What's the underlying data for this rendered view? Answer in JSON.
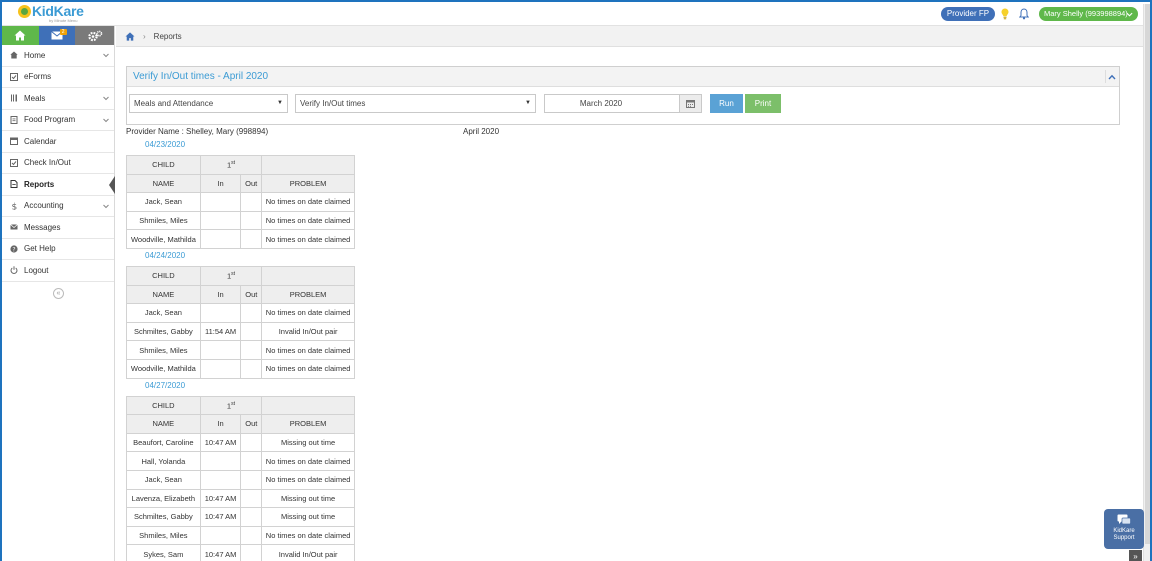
{
  "app": {
    "logo_text": "KidKare",
    "logo_subtext": "by Minute Menu",
    "provider_pill": "Provider FP",
    "user_pill": "Mary Shelly (993998894)",
    "mail_badge": "2"
  },
  "sidebar": {
    "items": [
      {
        "label": "Home",
        "icon": "home-icon",
        "has_chevron": true
      },
      {
        "label": "eForms",
        "icon": "checkbox-icon",
        "has_chevron": false
      },
      {
        "label": "Meals",
        "icon": "utensils-icon",
        "has_chevron": true
      },
      {
        "label": "Food Program",
        "icon": "document-icon",
        "has_chevron": true
      },
      {
        "label": "Calendar",
        "icon": "calendar-icon",
        "has_chevron": false
      },
      {
        "label": "Check In/Out",
        "icon": "checkin-icon",
        "has_chevron": false
      },
      {
        "label": "Reports",
        "icon": "report-icon",
        "has_chevron": false,
        "active": true
      },
      {
        "label": "Accounting",
        "icon": "dollar-icon",
        "has_chevron": true
      },
      {
        "label": "Messages",
        "icon": "envelope-icon",
        "has_chevron": false
      },
      {
        "label": "Get Help",
        "icon": "help-icon",
        "has_chevron": false
      },
      {
        "label": "Logout",
        "icon": "power-icon",
        "has_chevron": false
      }
    ]
  },
  "breadcrumb": {
    "current": "Reports"
  },
  "panel": {
    "title": "Verify In/Out times - April 2020",
    "report_category": "Meals and Attendance",
    "report_type": "Verify In/Out times",
    "date_value": "March 2020",
    "run_label": "Run",
    "print_label": "Print"
  },
  "report": {
    "provider_name": "Provider Name : Shelley, Mary (998894)",
    "month": "April 2020",
    "header": {
      "child": "CHILD",
      "day": "1",
      "day_suffix": "st",
      "name": "NAME",
      "in": "In",
      "out": "Out",
      "problem": "PROBLEM"
    },
    "groups": [
      {
        "date": "04/23/2020",
        "rows": [
          {
            "name": "Jack, Sean",
            "in": "",
            "out": "",
            "problem": "No times on date claimed"
          },
          {
            "name": "Shmiles, Miles",
            "in": "",
            "out": "",
            "problem": "No times on date claimed"
          },
          {
            "name": "Woodville, Mathilda",
            "in": "",
            "out": "",
            "problem": "No times on date claimed"
          }
        ]
      },
      {
        "date": "04/24/2020",
        "rows": [
          {
            "name": "Jack, Sean",
            "in": "",
            "out": "",
            "problem": "No times on date claimed"
          },
          {
            "name": "Schmiltes, Gabby",
            "in": "11:54 AM",
            "out": "",
            "problem": "Invalid In/Out pair"
          },
          {
            "name": "Shmiles, Miles",
            "in": "",
            "out": "",
            "problem": "No times on date claimed"
          },
          {
            "name": "Woodville, Mathilda",
            "in": "",
            "out": "",
            "problem": "No times on date claimed"
          }
        ]
      },
      {
        "date": "04/27/2020",
        "rows": [
          {
            "name": "Beaufort, Caroline",
            "in": "10:47 AM",
            "out": "",
            "problem": "Missing out time"
          },
          {
            "name": "Hall, Yolanda",
            "in": "",
            "out": "",
            "problem": "No times on date claimed"
          },
          {
            "name": "Jack, Sean",
            "in": "",
            "out": "",
            "problem": "No times on date claimed"
          },
          {
            "name": "Lavenza, Elizabeth",
            "in": "10:47 AM",
            "out": "",
            "problem": "Missing out time"
          },
          {
            "name": "Schmiltes, Gabby",
            "in": "10:47 AM",
            "out": "",
            "problem": "Missing out time"
          },
          {
            "name": "Shmiles, Miles",
            "in": "",
            "out": "",
            "problem": "No times on date claimed"
          },
          {
            "name": "Sykes, Sam",
            "in": "10:47 AM",
            "out": "",
            "problem": "Invalid In/Out pair"
          }
        ]
      }
    ]
  },
  "support": {
    "label_line1": "KidKare",
    "label_line2": "Support"
  },
  "colors": {
    "brand_blue": "#3f70b8",
    "brand_green": "#5fb84a",
    "link_blue": "#3b9bd4"
  }
}
